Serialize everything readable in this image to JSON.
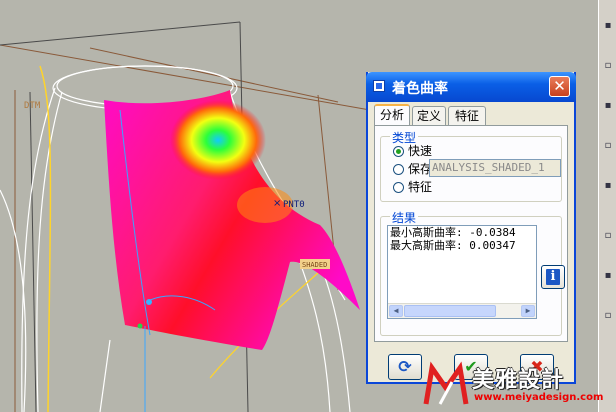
{
  "viewport": {
    "labels": {
      "dtm": "DTM",
      "pnt0": "PNT0",
      "shaded_tag": "SHADED"
    }
  },
  "dialog": {
    "title": "着色曲率",
    "close_glyph": "✕",
    "tabs": [
      "分析",
      "定义",
      "特征"
    ],
    "active_tab": "分析",
    "type_group": {
      "label": "类型",
      "options": [
        "快速",
        "保存",
        "特征"
      ],
      "selected": "快速"
    },
    "name_field": {
      "value": "ANALYSIS_SHADED_1"
    },
    "result_group": {
      "label": "结果",
      "lines": [
        "最小高斯曲率: -0.0384",
        "最大高斯曲率: 0.00347"
      ]
    },
    "info_glyph": "i",
    "footer_buttons": {
      "repaint_glyph": "⟳",
      "ok_glyph": "✔",
      "cancel_glyph": "✖"
    }
  },
  "watermark": {
    "text": "美雅設計",
    "url": "www.meiyadesign.com"
  },
  "colors": {
    "accent": "#0a5fe6",
    "surface_magenta": "#ff0ac8",
    "ok_green": "#1e9a1e",
    "cancel_red": "#d8261a"
  },
  "icons": [
    "window-icon",
    "close-icon",
    "info-icon",
    "repaint-icon",
    "ok-icon",
    "cancel-icon"
  ]
}
